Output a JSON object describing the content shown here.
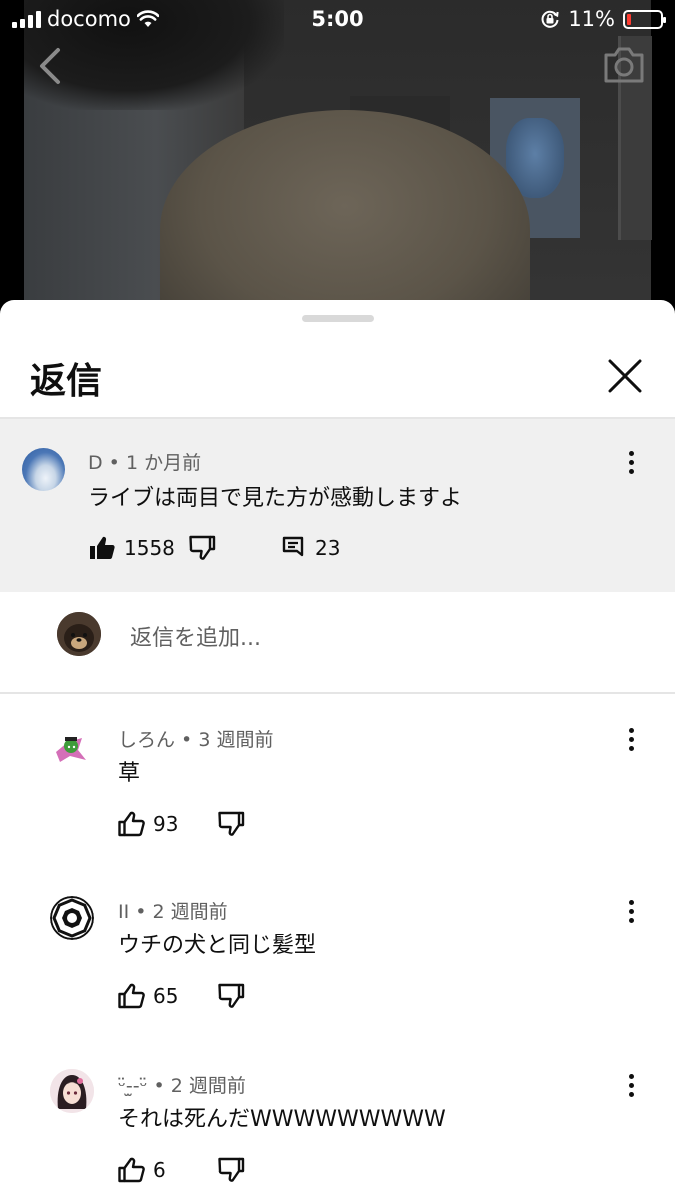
{
  "status_bar": {
    "carrier": "docomo",
    "time": "5:00",
    "battery": "11%",
    "battery_level": 0.11
  },
  "sheet": {
    "title": "返信"
  },
  "parent_comment": {
    "author": "D",
    "age": "1 か月前",
    "text": "ライブは両目で見た方が感動しますよ",
    "likes": "1558",
    "reply_count": "23"
  },
  "add_reply": {
    "placeholder": "返信を追加..."
  },
  "replies": [
    {
      "author": "しろん",
      "age": "3 週間前",
      "text": "草",
      "likes": "93"
    },
    {
      "author": "II",
      "age": "2 週間前",
      "text": "ウチの犬と同じ髪型",
      "likes": "65"
    },
    {
      "author": "ᵕ̈-̫-ᵕ̈",
      "age": "2 週間前",
      "text": "それは死んだWWWWWWWWW",
      "likes": "6"
    }
  ],
  "separator": " • "
}
